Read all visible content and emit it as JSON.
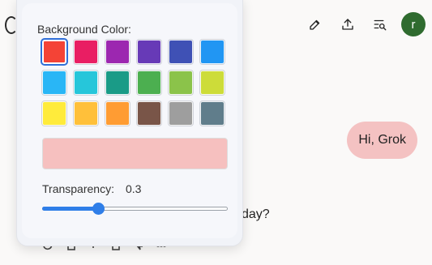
{
  "header": {
    "avatar_initial": "r",
    "avatar_color": "#2f6b2f",
    "icons": [
      "edit-icon",
      "upload-icon",
      "search-history-icon"
    ]
  },
  "chat": {
    "user_message": "Hi, Grok",
    "reply_fragment": "day?"
  },
  "picker": {
    "title": "Background Color:",
    "swatches": [
      "#f44336",
      "#e91e63",
      "#9c27b0",
      "#673ab7",
      "#3f51b5",
      "#2196f3",
      "#29b6f6",
      "#26c6da",
      "#1a9b87",
      "#4caf50",
      "#8bc34a",
      "#cddc39",
      "#ffeb3b",
      "#ffc03a",
      "#ff9c33",
      "#795548",
      "#9e9e9e",
      "#607d8b"
    ],
    "selected_color": "#f44336",
    "transparency_label": "Transparency:",
    "transparency_value": "0.3",
    "transparency_fraction": 0.3
  }
}
